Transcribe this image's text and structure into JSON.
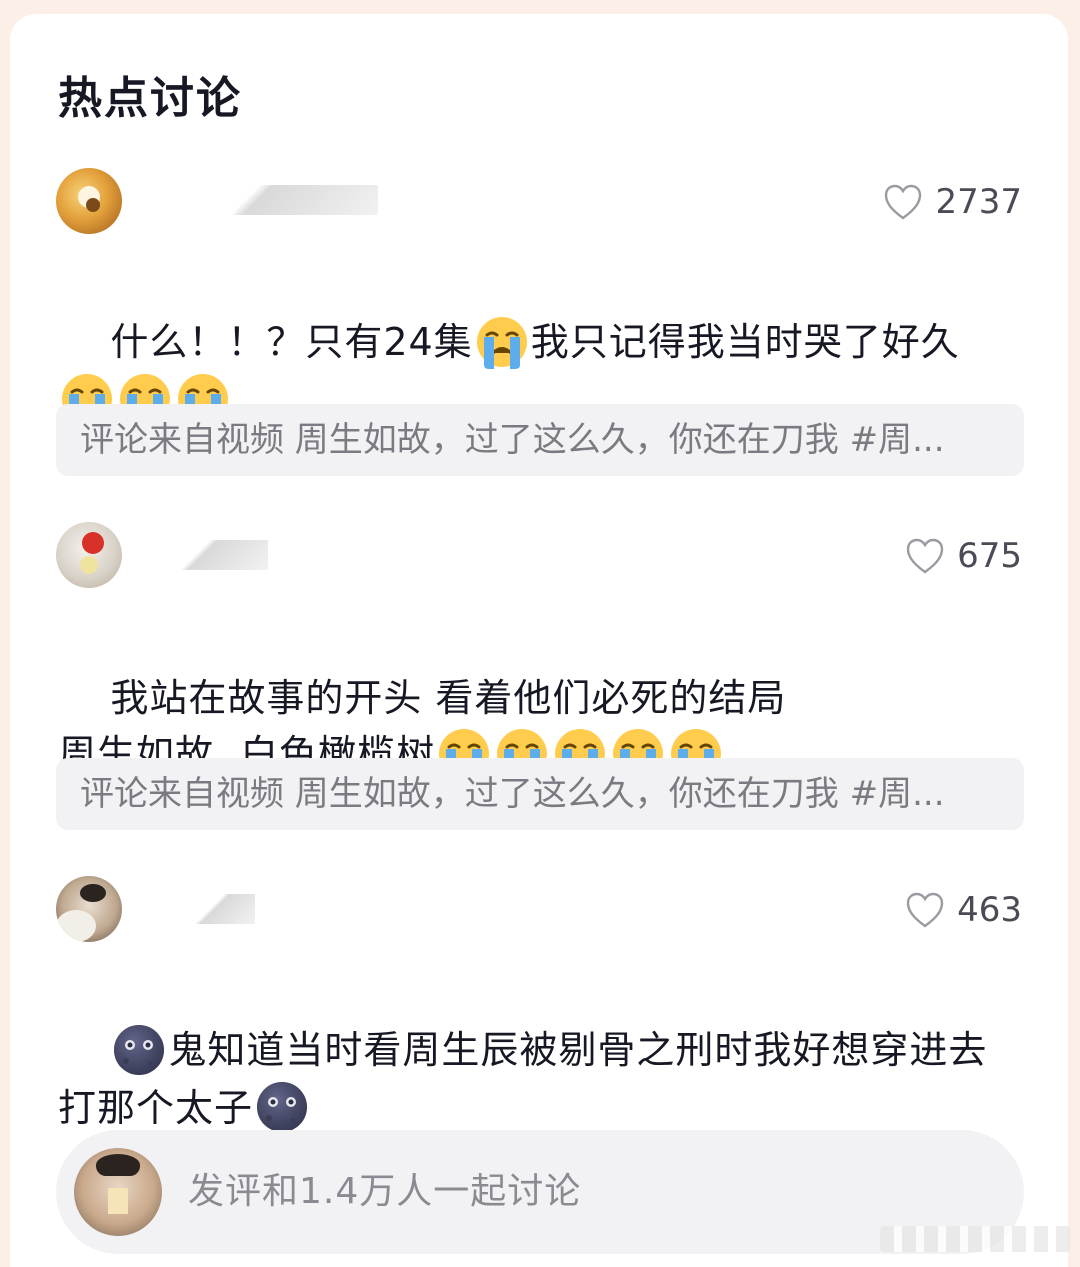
{
  "section": {
    "title": "热点讨论"
  },
  "comments": [
    {
      "likes": "2737",
      "line1_a": "什么！！？只有24集",
      "line1_b": "我只记得我当时哭了好久",
      "line2_emojis": 3,
      "source": "评论来自视频 周生如故，过了这么久，你还在刀我 #周..."
    },
    {
      "likes": "675",
      "line1": "我站在故事的开头 看着他们必死的结局",
      "line2": "周生如故  白色橄榄树",
      "line2_emojis": 5,
      "source": "评论来自视频 周生如故，过了这么久，你还在刀我 #周..."
    },
    {
      "likes": "463",
      "line1": "鬼知道当时看周生辰被剔骨之刑时我好想穿进去",
      "line2": "打那个太子"
    }
  ],
  "composer": {
    "placeholder": "发评和1.4万人一起讨论"
  },
  "icons": {
    "heart": "heart-outline-icon",
    "crying": "loudly-crying-emoji",
    "moon": "new-moon-face-emoji"
  },
  "colors": {
    "background": "#fbefe8",
    "card": "#ffffff",
    "source_bg": "#f2f2f4",
    "muted": "#7a7a82"
  }
}
